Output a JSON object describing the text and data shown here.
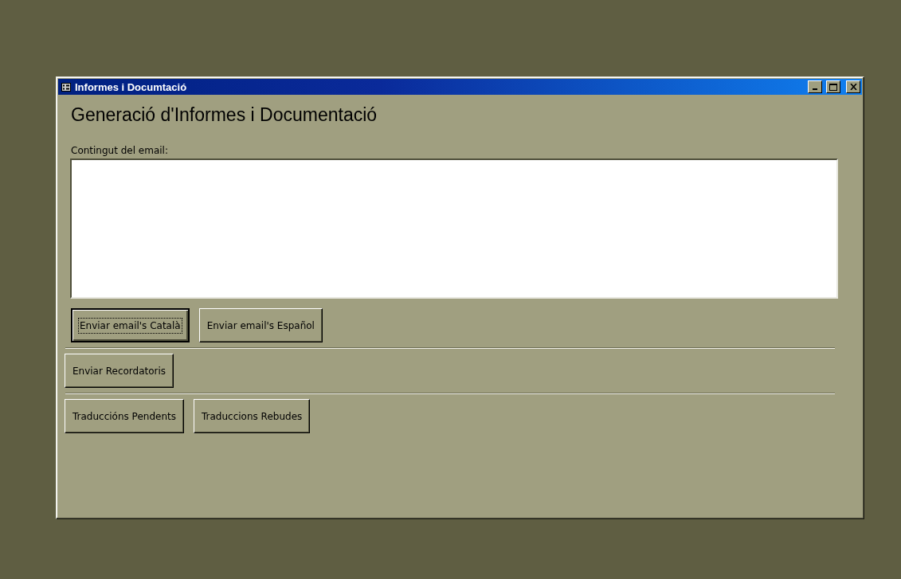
{
  "window": {
    "title": "Informes i Documtació"
  },
  "heading": "Generació d'Informes i Documentació",
  "email_field": {
    "label": "Contingut del email:"
  },
  "button_groups": [
    {
      "buttons": [
        {
          "label": "Enviar email's Català",
          "focused": true
        },
        {
          "label": "Enviar email's Español",
          "focused": false
        }
      ]
    },
    {
      "buttons": [
        {
          "label": "Enviar Recordatoris",
          "focused": false
        }
      ]
    },
    {
      "buttons": [
        {
          "label": "Traduccións Pendents",
          "focused": false
        },
        {
          "label": "Traduccions Rebudes",
          "focused": false
        }
      ]
    }
  ]
}
